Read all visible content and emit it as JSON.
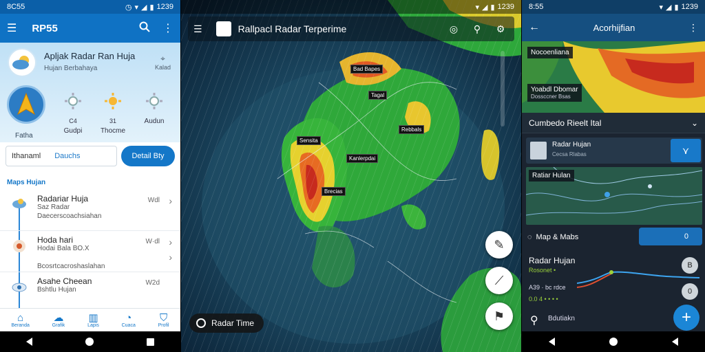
{
  "phone1": {
    "status_time": "8C55",
    "status_battery": "1239",
    "appbar_title": "RP55",
    "hero_title": "Apljak Radar Ran Huja",
    "hero_sub": "Hujan Berbahaya",
    "hero_right": "Kalad",
    "compass_label": "Fatha",
    "stats": [
      {
        "value": "C4",
        "label": "Gudpi"
      },
      {
        "value": "31",
        "label": "Thocme"
      },
      {
        "value": "",
        "label": "Audun"
      }
    ],
    "search_value": "Ithanaml",
    "search_hint": "Dauchs",
    "detail_button": "Detail Bty",
    "section_header": "Maps Hujan",
    "items": [
      {
        "title": "Radariar Huja",
        "line1": "Saz Radar",
        "line2": "Daecerscoachsiahan",
        "time": "Wdl"
      },
      {
        "title": "Hoda hari",
        "line1": "Hodai Bala BO.X",
        "line2": "Bcosrtcacroshaslahan",
        "time": "W·dl"
      },
      {
        "title": "Asahe Cheean",
        "line1": "Bshtlu Hujan",
        "line2": "",
        "time": "W2d"
      }
    ],
    "tabs": [
      "Beranda",
      "Grafik",
      "Lapis",
      "Cuaca",
      "Profil"
    ]
  },
  "phone2": {
    "status_battery": "1239",
    "appbar_title": "Rallpacl Radar Terperime",
    "map_labels": [
      "Bad Bapes",
      "Tagal",
      "Rebbals",
      "Sensita",
      "Kanlerpdai",
      "Brecias"
    ],
    "chip_label": "Radar Time"
  },
  "phone3": {
    "status_time": "8:55",
    "status_battery": "1239",
    "appbar_title": "Acorhijfian",
    "map_title": "Nocoenliana",
    "map_overlay_line1": "Yoabdl Dbomar",
    "map_overlay_line2": "Dossccner Bsas",
    "section_title": "Cumbedo Rieelt Ital",
    "card_title": "Radar Hujan",
    "card_sub": "Cecsa Rlabas",
    "map2_label": "Ratiar Hulan",
    "maps_title": "Map & Mabs",
    "maps_pill_value": "0",
    "rh_title": "Radar Hujan",
    "row_a": "Rosonet •",
    "row_b_label": "A39 · bc rdce",
    "row_c": "0.0 4 • • • •",
    "knob1": "B",
    "knob2": "0",
    "bottom_label": "Bdutiakn",
    "series_colors": {
      "green": "#9bd23c",
      "red": "#e05030",
      "blue": "#3da5f0"
    }
  }
}
